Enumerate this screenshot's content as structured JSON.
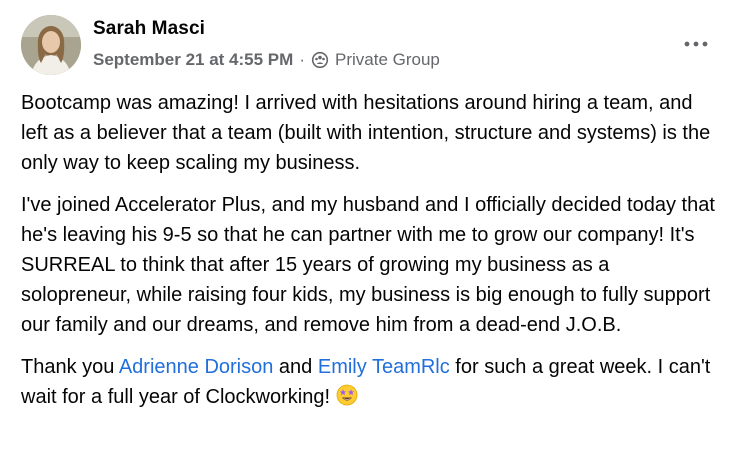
{
  "post": {
    "author": "Sarah Masci",
    "timestamp": "September 21 at 4:55 PM",
    "separator": "·",
    "audience": "Private Group",
    "audience_icon": "private-group-icon",
    "more_icon": "more-options-icon",
    "paragraphs": {
      "p1": "Bootcamp was amazing! I arrived with hesitations around hiring a team, and left as a believer that a team (built with intention, structure and systems) is the only way to keep scaling my business.",
      "p2": "I've joined Accelerator Plus, and my husband and I officially decided today that he's leaving his 9-5 so that he can partner with me to grow our company! It's SURREAL to think that after 15 years of growing my business as a solopreneur, while raising four kids, my business is big enough to fully support our family and our dreams, and remove him from a dead-end J.O.B.",
      "p3_before": "Thank you ",
      "mention1": "Adrienne Dorison",
      "p3_mid": " and ",
      "mention2": "Emily TeamRlc",
      "p3_after": " for such a great week. I can't wait for a full year of Clockworking! "
    },
    "emoji": "star-struck-emoji",
    "colors": {
      "text": "#050505",
      "secondary": "#65676b",
      "link": "#216fdb"
    }
  }
}
